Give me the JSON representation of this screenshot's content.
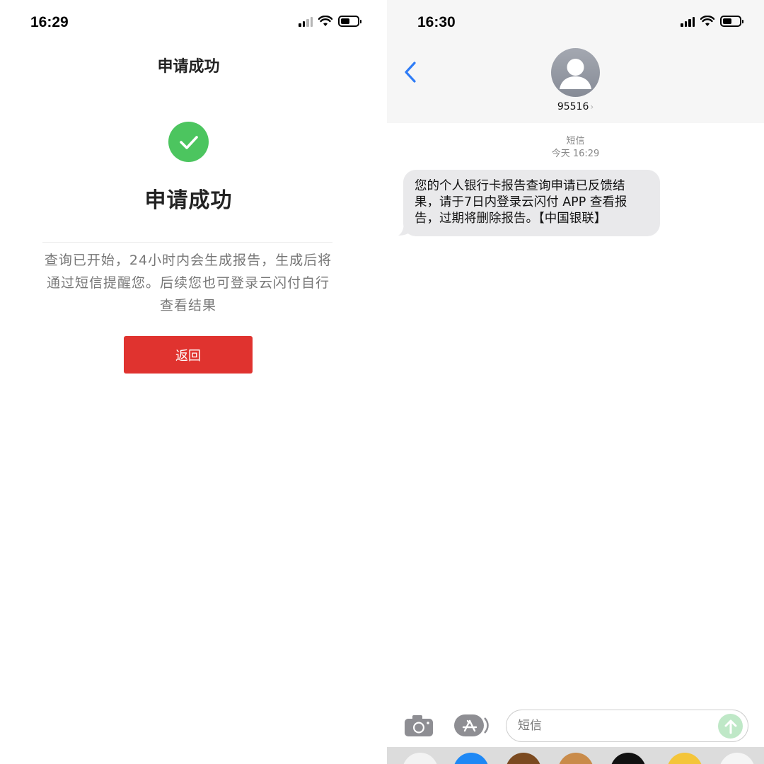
{
  "left": {
    "status": {
      "time": "16:29"
    },
    "nav_title": "申请成功",
    "success_title": "申请成功",
    "description": "查询已开始，24小时内会生成报告，生成后将通过短信提醒您。后续您也可登录云闪付自行查看结果",
    "back_button": "返回",
    "colors": {
      "success": "#4cc55f",
      "button": "#e0332f"
    }
  },
  "right": {
    "status": {
      "time": "16:30"
    },
    "contact": {
      "name": "95516"
    },
    "thread": {
      "label": "短信",
      "timestamp": "今天 16:29",
      "messages": [
        {
          "text": "您的个人银行卡报告查询申请已反馈结果，请于7日内登录云闪付 APP 查看报告，过期将删除报告。【中国银联】",
          "direction": "incoming"
        }
      ]
    },
    "composer": {
      "placeholder": "短信"
    },
    "icons": [
      "back-chevron-icon",
      "avatar-icon",
      "camera-icon",
      "app-store-icon",
      "send-arrow-icon"
    ]
  }
}
